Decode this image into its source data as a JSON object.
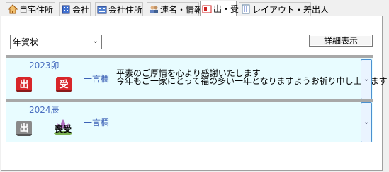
{
  "tabs": [
    {
      "label": "自宅住所",
      "icon": "house-icon",
      "color": "#d07a20"
    },
    {
      "label": "会社",
      "icon": "building-icon",
      "color": "#3060c0"
    },
    {
      "label": "会社住所",
      "icon": "office-address-icon",
      "color": "#3060c0"
    },
    {
      "label": "連名・情報",
      "icon": "people-icon",
      "color": "#5a7a9a"
    },
    {
      "label": "出・受",
      "icon": "postcard-icon",
      "color": "#d02020",
      "active": true
    },
    {
      "label": "レイアウト・差出人",
      "icon": "layout-icon",
      "color": "#6080a0"
    }
  ],
  "filter": {
    "selected": "年賀状"
  },
  "detail_button": "詳細表示",
  "rows": [
    {
      "year": "2023卯",
      "sent_mark": "出",
      "received_mark": "受",
      "hitokoto_label": "一言欄",
      "message_lines": [
        "平素のご厚情を心より感謝いたします",
        "今年もご一家にとって福の多い一年となりますようお祈り申し上げます"
      ]
    },
    {
      "year": "2024辰",
      "sent_mark": "出",
      "received_mark": "喪受",
      "hitokoto_label": "一言欄",
      "message_lines": []
    }
  ],
  "colors": {
    "list_bg": "#e8fcff",
    "accent_blue": "#3a5fb5",
    "stamp_red": "#d8262a"
  }
}
